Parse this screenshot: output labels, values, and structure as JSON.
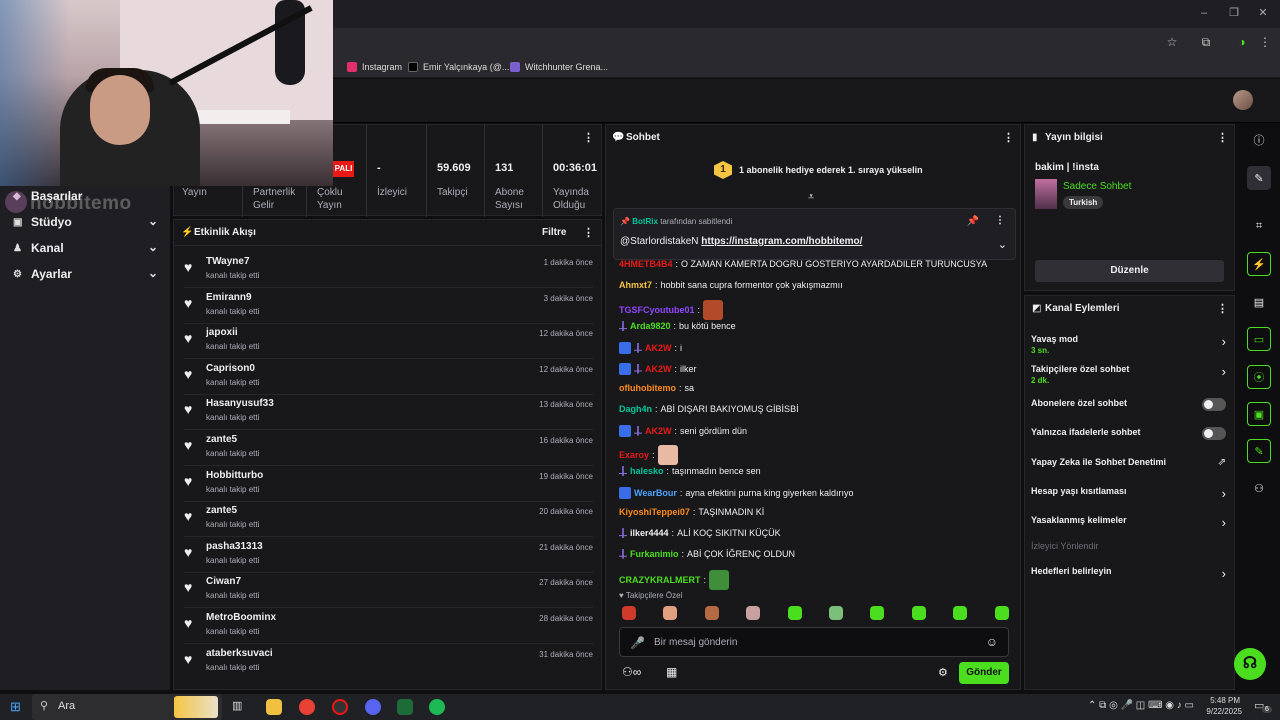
{
  "browser": {
    "bookmarks": [
      {
        "label": "Instagram",
        "color": "#e1306c"
      },
      {
        "label": "Emir Yalçınkaya (@...",
        "color": "#000000"
      },
      {
        "label": "Witchhunter Grena...",
        "color": "#7a5fcf"
      }
    ]
  },
  "webcam": {
    "watermark": "hobbitemo"
  },
  "leftnav": {
    "items": [
      {
        "label": "Başarılar"
      },
      {
        "label": "Stüdyo"
      },
      {
        "label": "Kanal"
      },
      {
        "label": "Ayarlar"
      }
    ]
  },
  "stats": {
    "badge": "PALI",
    "items": [
      {
        "value": "",
        "label": "Yayın"
      },
      {
        "value": "",
        "label": "Partnerlik Gelir"
      },
      {
        "value": "",
        "label": "Çoklu Yayın"
      },
      {
        "value": "-",
        "label": "İzleyici"
      },
      {
        "value": "59.609",
        "label": "Takipçi"
      },
      {
        "value": "131",
        "label": "Abone Sayısı"
      },
      {
        "value": "00:36:01",
        "label": "Yayında Olduğu Süre"
      }
    ]
  },
  "activity": {
    "title": "Etkinlik Akışı",
    "filter_label": "Filtre",
    "events": [
      {
        "user": "TWayne7",
        "action": "kanalı takip etti",
        "time": "1 dakika önce"
      },
      {
        "user": "Emirann9",
        "action": "kanalı takip etti",
        "time": "3 dakika önce"
      },
      {
        "user": "japoxii",
        "action": "kanalı takip etti",
        "time": "12 dakika önce"
      },
      {
        "user": "Caprison0",
        "action": "kanalı takip etti",
        "time": "12 dakika önce"
      },
      {
        "user": "Hasanyusuf33",
        "action": "kanalı takip etti",
        "time": "13 dakika önce"
      },
      {
        "user": "zante5",
        "action": "kanalı takip etti",
        "time": "16 dakika önce"
      },
      {
        "user": "Hobbitturbo",
        "action": "kanalı takip etti",
        "time": "19 dakika önce"
      },
      {
        "user": "zante5",
        "action": "kanalı takip etti",
        "time": "20 dakika önce"
      },
      {
        "user": "pasha31313",
        "action": "kanalı takip etti",
        "time": "21 dakika önce"
      },
      {
        "user": "Ciwan7",
        "action": "kanalı takip etti",
        "time": "27 dakika önce"
      },
      {
        "user": "MetroBoominx",
        "action": "kanalı takip etti",
        "time": "28 dakika önce"
      },
      {
        "user": "ataberksuvaci",
        "action": "kanalı takip etti",
        "time": "31 dakika önce"
      }
    ]
  },
  "chat": {
    "title": "Sohbet",
    "hype_level": "1",
    "hype_text": "1 abonelik hediye ederek 1. sıraya yükselin",
    "pinned_by_user": "BotRix",
    "pinned_by_suffix": "tarafından sabitlendi",
    "pinned_mention": "@StarlordistakeN",
    "pinned_link": "https://instagram.com/hobbitemo/",
    "messages": [
      {
        "user": "4HMETB4B4",
        "color": "#e91916",
        "text": "O ZAMAN KAMERTA DOGRU GOSTERIYO AYARDADILER TURUNCUSYA",
        "badge": "",
        "emote": ""
      },
      {
        "user": "Ahmxt7",
        "color": "#f5c543",
        "text": "hobbit sana cupra formentor çok yakışmazmıı",
        "badge": "",
        "emote": ""
      },
      {
        "user": "TGSFCyoutube01",
        "color": "#9146ff",
        "text": "",
        "badge": "",
        "emote": "#b34a2a"
      },
      {
        "user": "Arda9820",
        "color": "#4ade1e",
        "text": "bu kötü bence",
        "badge": "sword",
        "emote": ""
      },
      {
        "user": "AK2W",
        "color": "#e91916",
        "text": "i",
        "badge": "both",
        "emote": ""
      },
      {
        "user": "AK2W",
        "color": "#e91916",
        "text": "ilker",
        "badge": "both",
        "emote": ""
      },
      {
        "user": "ofluhobitemo",
        "color": "#ff8c1a",
        "text": "sa",
        "badge": "",
        "emote": ""
      },
      {
        "user": "Dagh4n",
        "color": "#00c79a",
        "text": "ABİ DIŞARI BAKIYOMUŞ GİBİSBİ",
        "badge": "",
        "emote": ""
      },
      {
        "user": "AK2W",
        "color": "#e91916",
        "text": "seni gördüm dün",
        "badge": "both",
        "emote": ""
      },
      {
        "user": "Exaroy",
        "color": "#e91916",
        "text": "",
        "badge": "",
        "emote": "#e8b9a3"
      },
      {
        "user": "halesko",
        "color": "#00c79a",
        "text": "taşınmadın bence sen",
        "badge": "sword",
        "emote": ""
      },
      {
        "user": "WearBour",
        "color": "#4aa3ff",
        "text": "ayna efektini purna king giyerken kaldırıyo",
        "badge": "bdg",
        "emote": ""
      },
      {
        "user": "KiyoshiTeppei07",
        "color": "#ff8c1a",
        "text": "TAŞINMADIN Kİ",
        "badge": "",
        "emote": ""
      },
      {
        "user": "ilker4444",
        "color": "#efeff1",
        "text": "ALİ KOÇ SIKITNI KÜÇÜK",
        "badge": "sword",
        "emote": ""
      },
      {
        "user": "Furkanimio",
        "color": "#4ade1e",
        "text": "ABİ ÇOK İĞRENÇ OLDUN",
        "badge": "sword",
        "emote": ""
      },
      {
        "user": "CRAZYKRALMERT",
        "color": "#4ade1e",
        "text": "",
        "badge": "",
        "emote": "#3f8f3a"
      }
    ],
    "followers_only_label": "Takipçilere Özel",
    "emote_colors": [
      "#d03a2a",
      "#e0a080",
      "#b46a44",
      "#c8a0a0",
      "#4ade1e",
      "#7ac07a",
      "#4ade1e",
      "#4ade1e",
      "#4ade1e",
      "#4ade1e"
    ],
    "input_placeholder": "Bir mesaj gönderin",
    "send_label": "Gönder"
  },
  "stream_info": {
    "title": "Yayın bilgisi",
    "stream_title": "bakim | !insta",
    "category": "Sadece Sohbet",
    "language_tag": "Turkish",
    "edit_label": "Düzenle"
  },
  "channel_actions": {
    "title": "Kanal Eylemleri",
    "items": [
      {
        "label": "Yavaş mod",
        "sub": "3 sn.",
        "control": "chevron"
      },
      {
        "label": "Takipçilere özel sohbet",
        "sub": "2 dk.",
        "control": "chevron"
      },
      {
        "label": "Abonelere özel sohbet",
        "sub": "",
        "control": "toggle"
      },
      {
        "label": "Yalnızca ifadelerle sohbet",
        "sub": "",
        "control": "toggle"
      },
      {
        "label": "Yapay Zeka ile Sohbet Denetimi",
        "sub": "",
        "control": "external"
      },
      {
        "label": "Hesap yaşı kısıtlaması",
        "sub": "",
        "control": "chevron"
      },
      {
        "label": "Yasaklanmış kelimeler",
        "sub": "",
        "control": "chevron"
      },
      {
        "label": "İzleyici Yönlendir",
        "sub": "",
        "control": "disabled"
      },
      {
        "label": "Hedefleri belirleyin",
        "sub": "",
        "control": "chevron"
      }
    ]
  },
  "taskbar": {
    "search_label": "Ara",
    "time": "5:48 PM",
    "date": "9/22/2025",
    "notif_count": "6"
  }
}
